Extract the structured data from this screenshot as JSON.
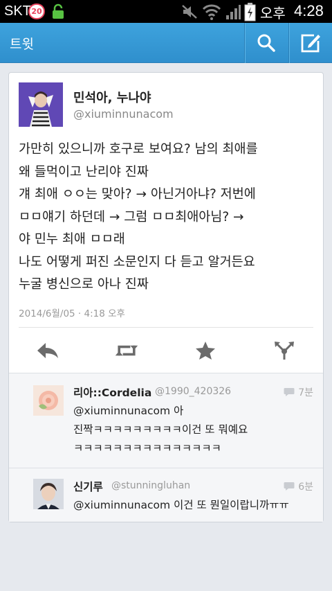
{
  "status_bar": {
    "carrier": "SKT",
    "badge": "20",
    "ampm": "오후",
    "time": "4:28",
    "icons": [
      "lock-icon",
      "mute-icon",
      "wifi-icon",
      "signal-icon",
      "battery-charging-icon"
    ]
  },
  "action_bar": {
    "title": "트윗",
    "color": "#359ad6",
    "buttons": [
      {
        "name": "search",
        "icon": "search-icon"
      },
      {
        "name": "compose",
        "icon": "compose-icon"
      }
    ]
  },
  "tweet": {
    "author_name": "민석아, 누나야",
    "author_handle": "@xiuminnunacom",
    "text": "가만히 있으니까 호구로 보여요? 남의 최애를\n왜 들먹이고 난리야 진짜\n걔 최애 ㅇㅇ는 맞아? → 아닌거아냐? 저번에\nㅁㅁ얘기 하던데 → 그럼 ㅁㅁ최애아님? →\n야 민누 최애 ㅁㅁ래\n나도 어떻게 퍼진 소문인지 다 듣고 알거든요\n누굴 병신으로 아나 진짜",
    "timestamp": "2014/6월/05 · 4:18 오후",
    "actions": [
      "reply-icon",
      "retweet-icon",
      "favorite-icon",
      "share-icon"
    ]
  },
  "replies": [
    {
      "name": "리아::Cordelia",
      "handle": "@1990_420326",
      "time": "7분",
      "text": "@xiuminnunacom 아\n진짝ㅋㅋㅋㅋㅋㅋㅋㅋㅋ이건 또 뭐예요\nㅋㅋㅋㅋㅋㅋㅋㅋㅋㅋㅋㅋㅋㅋㅋ"
    },
    {
      "name": "신기루",
      "handle": "@stunningluhan",
      "time": "6분",
      "text": "@xiuminnunacom 이건 또 뭔일이랍니까ㅠㅠ"
    }
  ]
}
